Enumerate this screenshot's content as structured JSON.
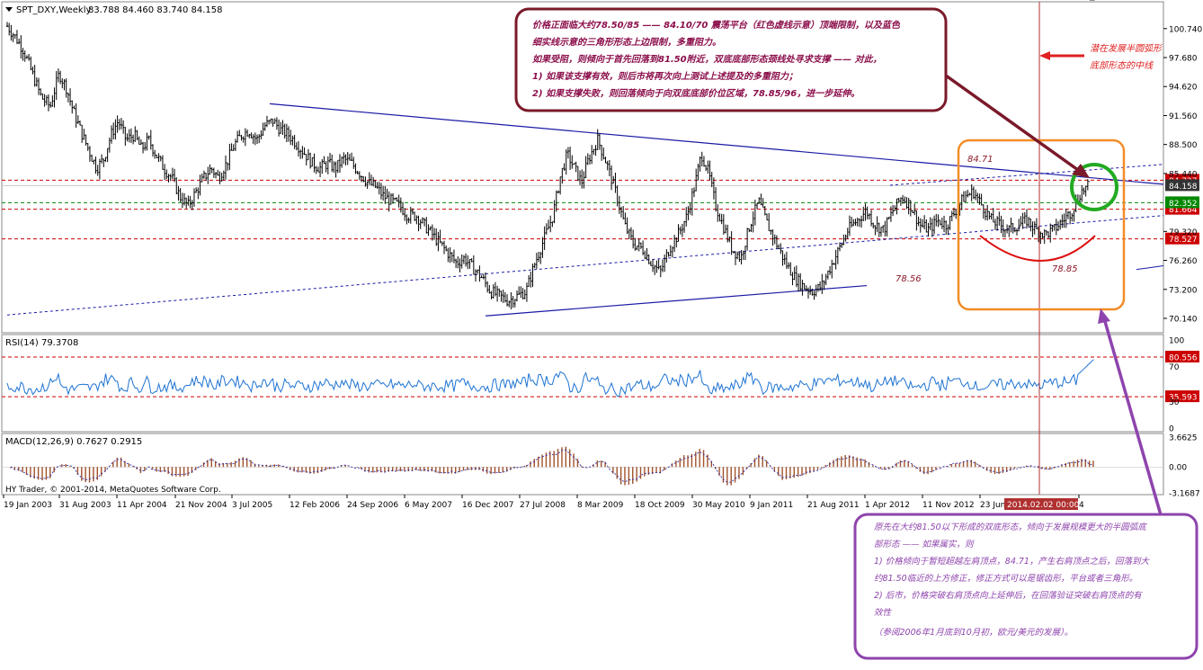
{
  "window": {
    "title": "SPT_DXY,Weekly",
    "ohlc": "83.788 84.460 83.740 84.158",
    "copyright": "HY Trader, © 2001-2014, MetaQuotes Software Corp."
  },
  "chart_data": [
    {
      "type": "candlestick",
      "title": "SPT_DXY,Weekly",
      "ylim": [
        69.0,
        103.0
      ],
      "yticks": [
        "100.740",
        "97.680",
        "94.620",
        "91.560",
        "88.500",
        "85.440",
        "84.158",
        "79.320",
        "76.260",
        "73.200",
        "70.140"
      ],
      "xticks": [
        "19 Jan 2003",
        "31 Aug 2003",
        "11 Apr 2004",
        "21 Nov 2004",
        "3 Jul 2005",
        "12 Feb 2006",
        "24 Sep 2006",
        "6 May 2007",
        "16 Dec 2007",
        "27 Jul 2008",
        "8 Mar 2009",
        "18 Oct 2009",
        "30 May 2010",
        "9 Jan 2011",
        "21 Aug 2011",
        "1 Apr 2012",
        "11 Nov 2012",
        "23 Jun",
        "2014.02.02 00:00",
        "4"
      ],
      "x": [
        0,
        8,
        18,
        28,
        38,
        48,
        58,
        66,
        74,
        84,
        93,
        100,
        108,
        116,
        124,
        133,
        142,
        150,
        158,
        166,
        175,
        184,
        193,
        202,
        211,
        220,
        228,
        236,
        245,
        254,
        262,
        270,
        279,
        288,
        297,
        306,
        315,
        324,
        333,
        341,
        349,
        358,
        367,
        376,
        385,
        394,
        403,
        412,
        421,
        430,
        439,
        448,
        457,
        466,
        475,
        484,
        493,
        502,
        511,
        520,
        530,
        540,
        550,
        560,
        570,
        580,
        590,
        600,
        610,
        618,
        626,
        634,
        642,
        650,
        660,
        670,
        680,
        690,
        700,
        710,
        720,
        730,
        740,
        750,
        760,
        768,
        776,
        784,
        792,
        800,
        810,
        820,
        830,
        840,
        850,
        860,
        870,
        880,
        890,
        900,
        910,
        920,
        930,
        940,
        950,
        960,
        970,
        980,
        990,
        1000,
        1010,
        1020,
        1030,
        1040,
        1050,
        1060,
        1070,
        1080,
        1090,
        1100,
        1110,
        1120,
        1130,
        1140,
        1150,
        1160,
        1170,
        1180,
        1190,
        1200,
        1210,
        1216
      ],
      "close": [
        101.0,
        100.0,
        98.5,
        96.0,
        93.5,
        92.5,
        96.0,
        94.5,
        92.0,
        89.5,
        87.5,
        86.0,
        87.0,
        89.5,
        91.0,
        89.0,
        89.5,
        88.0,
        89.0,
        87.5,
        86.0,
        85.0,
        83.0,
        82.0,
        83.5,
        85.0,
        86.0,
        85.0,
        86.5,
        88.5,
        89.5,
        90.0,
        89.0,
        90.5,
        91.0,
        90.0,
        89.5,
        88.5,
        87.5,
        86.5,
        86.0,
        86.5,
        86.0,
        87.0,
        86.5,
        85.5,
        84.5,
        84.0,
        83.0,
        82.5,
        82.0,
        81.0,
        81.0,
        80.0,
        79.0,
        78.0,
        77.0,
        76.0,
        76.5,
        75.5,
        74.5,
        73.0,
        72.5,
        72.0,
        72.5,
        73.0,
        76.0,
        78.5,
        81.0,
        85.0,
        87.5,
        86.0,
        84.5,
        87.0,
        89.0,
        86.5,
        83.5,
        80.0,
        78.0,
        77.5,
        76.0,
        75.0,
        77.5,
        79.0,
        81.0,
        84.0,
        87.5,
        85.5,
        82.0,
        80.0,
        77.5,
        76.5,
        80.0,
        82.5,
        80.0,
        78.0,
        76.0,
        74.5,
        73.5,
        73.0,
        73.5,
        75.5,
        77.5,
        79.5,
        80.5,
        81.5,
        80.0,
        79.5,
        81.5,
        83.0,
        82.0,
        80.0,
        79.5,
        80.5,
        80.0,
        81.5,
        83.0,
        83.5,
        82.0,
        80.5,
        80.0,
        79.5,
        80.0,
        80.5,
        79.5,
        79.0,
        79.5,
        80.5,
        81.5,
        83.5,
        84.158
      ]
    },
    {
      "type": "line",
      "title": "RSI(14) 79.3708",
      "ylim": [
        0,
        100
      ],
      "yticks": [
        "100",
        "80.556",
        "70",
        "35.593",
        "30",
        "0"
      ],
      "levels": [
        80.556,
        35.593
      ],
      "last": 79.3708
    },
    {
      "type": "bar",
      "title": "MACD(12,26,9) 0.7627 0.2915",
      "ylim": [
        -3.1687,
        3.6625
      ],
      "yticks": [
        "3.6625",
        "0.00",
        "-3.1687"
      ],
      "macd": 0.7627,
      "signal": 0.2915
    }
  ],
  "levels": {
    "red_dashed": [
      {
        "label": "84.727",
        "value": 84.727,
        "color": "#cc0000"
      },
      {
        "label": "81.664",
        "value": 81.664,
        "color": "#cc0000"
      },
      {
        "label": "78.527",
        "value": 78.527,
        "color": "#cc0000"
      }
    ],
    "green_dashed": {
      "label": "82.352",
      "value": 82.352,
      "color": "#008800"
    },
    "price_label": {
      "label": "84.158",
      "value": 84.158
    }
  },
  "chart_notes": {
    "top_peak": "84.71",
    "double_bottom": "78.56",
    "right_bottom": "78.85"
  },
  "callouts": {
    "top": {
      "lines": [
        "价格正面临大约78.50/85 —— 84.10/70 震荡平台（红色虚线示意）顶端限制，以及蓝色",
        "细实线示意的三角形形态上边限制，多重阻力。",
        "如果受阻，则倾向于首先回落到81.50附近，双底底部形态颈线处寻求支撑 —— 对此，",
        "1) 如果该支撑有效，则后市将再次向上测试上述提及的多重阻力；",
        "2) 如果支撑失败，则回落倾向于向双底底部价位区域，78.85/96，进一步延伸。"
      ]
    },
    "right": {
      "lines": [
        "潜在发展半圆弧形",
        "底部形态的中线"
      ]
    },
    "bottom": {
      "lines": [
        "原先在大约81.50以下形成的双底形态，倾向于发展规模更大的半圆弧底",
        "部形态 —— 如果属实，则",
        "1) 价格倾向于暂短超越左肩顶点，84.71，产生右肩顶点之后，回落到大",
        "约81.50临近的上方修正，修正方式可以是锯齿形，平台或者三角形。",
        "2) 后市，价格突破右肩顶点向上延伸后，在回落验证突破右肩顶点的有",
        "效性",
        "（参阅2006年1月底到10月初，欧元/美元的发展）。"
      ]
    }
  },
  "colors": {
    "bull": "#000000",
    "bear": "#000000",
    "rsi": "#1e73d2",
    "macd_hist": "#a0522d",
    "trendline": "#1a1aa6",
    "callout_top_border": "#7a1a2a",
    "callout_bottom_border": "#8e44ad",
    "orange_box": "#f28c28",
    "green_circle": "#22aa22",
    "red_arc": "#dd1111"
  }
}
